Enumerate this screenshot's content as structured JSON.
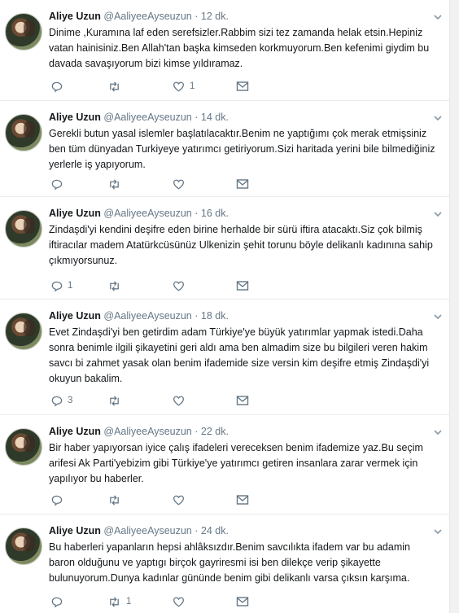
{
  "tweets": [
    {
      "name": "Aliye Uzun",
      "handle": "@AaliyeeAyseuzun",
      "sep": "·",
      "time": "12 dk.",
      "text": "Dinime ,Kuramına laf eden serefsizler.Rabbim sizi tez zamanda helak etsin.Hepiniz vatan hainisiniz.Ben Allah'tan başka kimseden korkmuyorum.Ben kefenimi giydim bu davada savaşıyorum bizi kimse yıldıramaz.",
      "reply_count": "",
      "retweet_count": "",
      "like_count": "1"
    },
    {
      "name": "Aliye Uzun",
      "handle": "@AaliyeeAyseuzun",
      "sep": "·",
      "time": "14 dk.",
      "text": "Gerekli butun yasal islemler başlatılacaktır.Benim ne yaptığımı çok merak etmişsiniz ben tüm dünyadan Turkiyeye yatırımcı getiriyorum.Sizi haritada yerini bile bilmediğiniz yerlerle iş yapıyorum.",
      "reply_count": "",
      "retweet_count": "",
      "like_count": ""
    },
    {
      "name": "Aliye Uzun",
      "handle": "@AaliyeeAyseuzun",
      "sep": "·",
      "time": "16 dk.",
      "text": "Zindaşdi'yi kendini deşifre eden birine herhalde bir sürü iftira atacaktı.Siz çok bilmiş iftiracılar madem Atatürkcüsünüz Ulkenizin şehit torunu böyle delikanlı kadınına sahip çıkmıyorsunuz.",
      "reply_count": "1",
      "retweet_count": "",
      "like_count": ""
    },
    {
      "name": "Aliye Uzun",
      "handle": "@AaliyeeAyseuzun",
      "sep": "·",
      "time": "18 dk.",
      "text": "Evet Zindaşdi'yi ben getirdim adam Türkiye'ye büyük yatırımlar yapmak istedi.Daha sonra benimle ilgili şikayetini geri aldı ama ben almadim  size bu bilgileri veren hakim savcı bi zahmet yasak olan benim ifademide size versin kim deşifre etmiş Zindaşdi'yi okuyun bakalim.",
      "reply_count": "3",
      "retweet_count": "",
      "like_count": ""
    },
    {
      "name": "Aliye Uzun",
      "handle": "@AaliyeeAyseuzun",
      "sep": "·",
      "time": "22 dk.",
      "text": "Bir haber yapıyorsan iyice çalış ifadeleri vereceksen benim ifademize yaz.Bu seçim arifesi Ak Parti'yebizim gibi Türkiye'ye yatırımcı getiren insanlara zarar vermek için yapılıyor bu haberler.",
      "reply_count": "",
      "retweet_count": "",
      "like_count": ""
    },
    {
      "name": "Aliye Uzun",
      "handle": "@AaliyeeAyseuzun",
      "sep": "·",
      "time": "24 dk.",
      "text": "Bu haberleri yapanların hepsi ahlâksızdır.Benim savcılıkta ifadem var bu adamin baron olduğunu ve yaptıgı birçok gayriresmi isi ben dilekçe verip şikayette bulunuyorum.Dunya kadınlar gününde benim gibi delikanlı varsa çıksın karşıma.",
      "reply_count": "",
      "retweet_count": "1",
      "like_count": ""
    }
  ]
}
